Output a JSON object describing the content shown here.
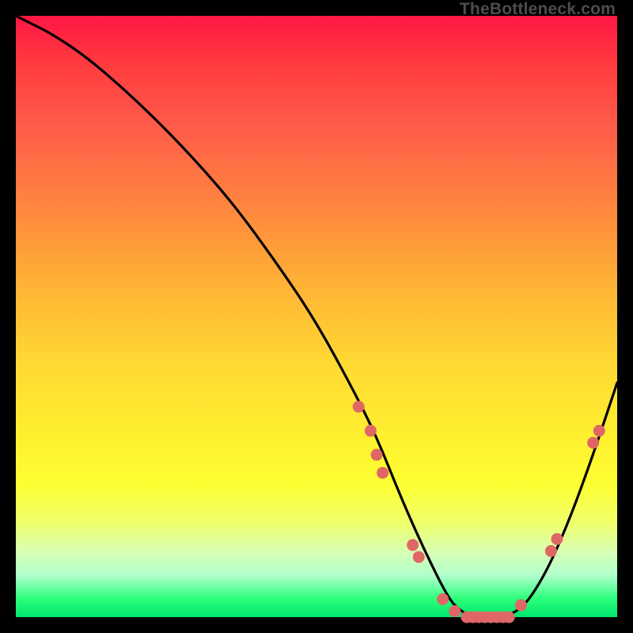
{
  "branding": {
    "site": "TheBottleneck.com"
  },
  "chart_data": {
    "type": "line",
    "title": "",
    "xlabel": "",
    "ylabel": "",
    "xlim": [
      0,
      100
    ],
    "ylim": [
      0,
      100
    ],
    "series": [
      {
        "name": "bottleneck-curve",
        "x": [
          0,
          2,
          6,
          12,
          20,
          28,
          36,
          44,
          50,
          56,
          60,
          64,
          68,
          72,
          74,
          76,
          80,
          84,
          88,
          92,
          96,
          100
        ],
        "values": [
          100,
          99,
          97,
          93,
          86,
          78,
          69,
          58,
          49,
          38,
          30,
          20,
          11,
          3,
          1,
          0,
          0,
          1,
          7,
          16,
          27,
          39
        ]
      }
    ],
    "markers": {
      "name": "highlight-points",
      "color": "#e06666",
      "points": [
        {
          "x": 57,
          "y": 35
        },
        {
          "x": 59,
          "y": 31
        },
        {
          "x": 60,
          "y": 27
        },
        {
          "x": 61,
          "y": 24
        },
        {
          "x": 66,
          "y": 12
        },
        {
          "x": 67,
          "y": 10
        },
        {
          "x": 71,
          "y": 3
        },
        {
          "x": 73,
          "y": 1
        },
        {
          "x": 75,
          "y": 0
        },
        {
          "x": 76,
          "y": 0
        },
        {
          "x": 77,
          "y": 0
        },
        {
          "x": 78,
          "y": 0
        },
        {
          "x": 79,
          "y": 0
        },
        {
          "x": 80,
          "y": 0
        },
        {
          "x": 81,
          "y": 0
        },
        {
          "x": 82,
          "y": 0
        },
        {
          "x": 84,
          "y": 2
        },
        {
          "x": 89,
          "y": 11
        },
        {
          "x": 90,
          "y": 13
        },
        {
          "x": 96,
          "y": 29
        },
        {
          "x": 97,
          "y": 31
        }
      ]
    }
  }
}
